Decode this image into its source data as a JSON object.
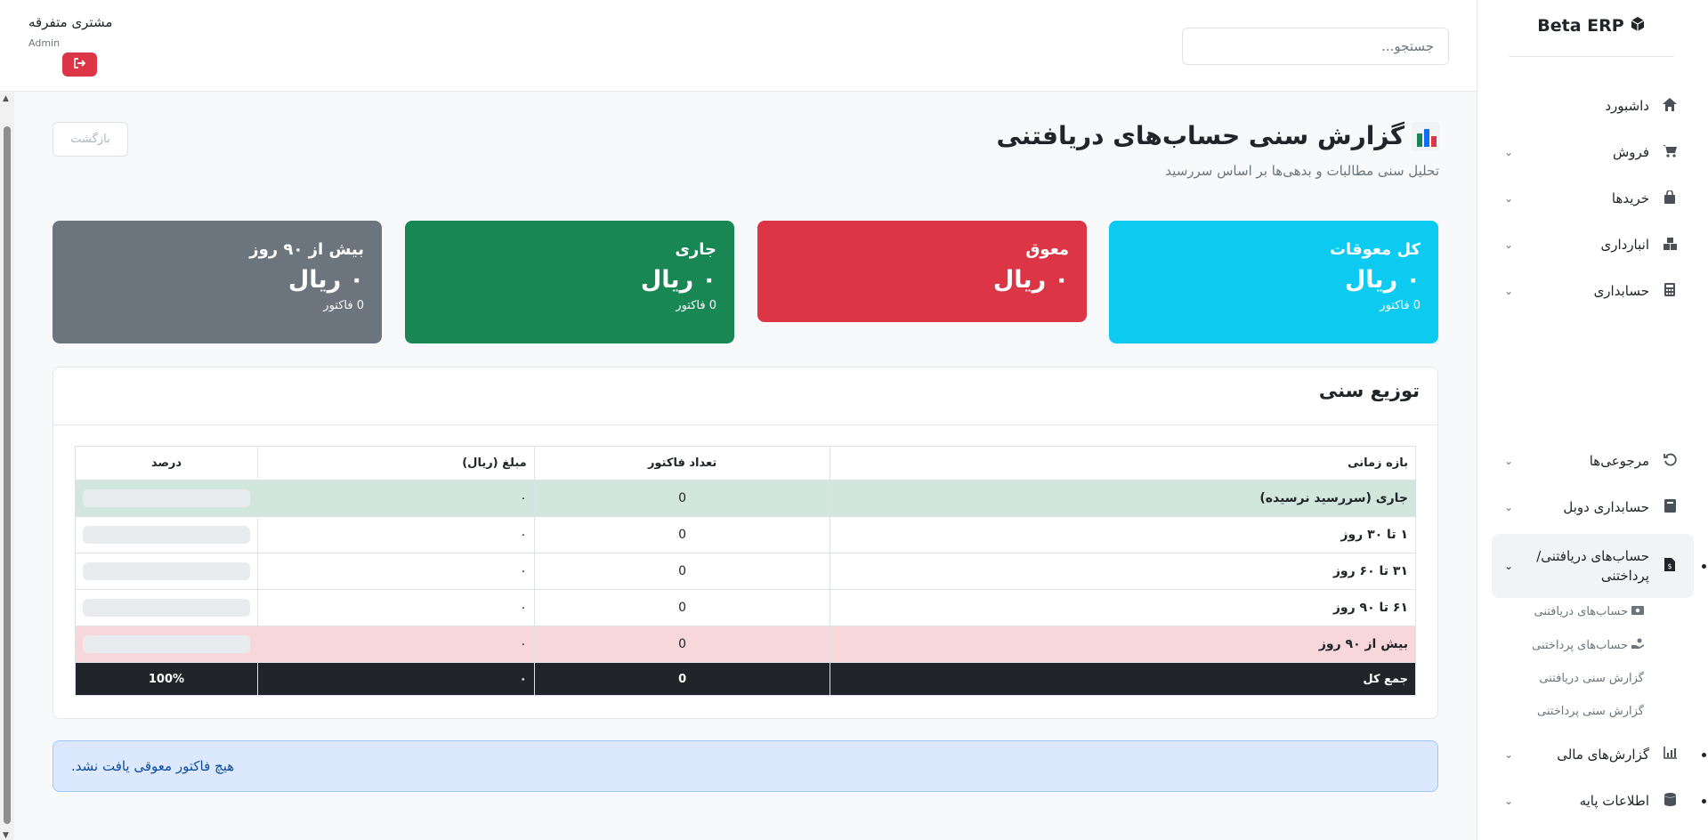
{
  "brand": {
    "title": "Beta ERP",
    "icon": "cube-icon"
  },
  "sidebar": {
    "items": [
      {
        "label": "داشبورد",
        "icon": "home-icon",
        "has_chevron": false
      },
      {
        "label": "فروش",
        "icon": "cart-icon",
        "has_chevron": true
      },
      {
        "label": "خریدها",
        "icon": "bag-icon",
        "has_chevron": true
      },
      {
        "label": "انبارداری",
        "icon": "warehouse-icon",
        "has_chevron": true
      },
      {
        "label": "حسابداری",
        "icon": "calculator-icon",
        "has_chevron": true
      },
      {
        "label": "مرجوعی‌ها",
        "icon": "undo-icon",
        "has_chevron": true
      },
      {
        "label": "حسابداری دوبل",
        "icon": "book-icon",
        "has_chevron": true
      },
      {
        "label": "حساب‌های دریافتنی/\nپرداختنی",
        "icon": "invoice-dollar-icon",
        "has_chevron": true,
        "active": true
      },
      {
        "label": "گزارش‌های مالی",
        "icon": "chart-icon",
        "has_chevron": true
      },
      {
        "label": "اطلاعات پایه",
        "icon": "database-icon",
        "has_chevron": true
      }
    ],
    "sub_items": [
      {
        "label": "حساب‌های دریافتنی",
        "icon": "money-icon"
      },
      {
        "label": "حساب‌های پرداختنی",
        "icon": "hand-money-icon"
      },
      {
        "label": "گزارش سنی دریافتنی"
      },
      {
        "label": "گزارش سنی پرداختنی"
      }
    ]
  },
  "header": {
    "search_placeholder": "جستجو...",
    "user_name": "مشتری متفرقه",
    "user_role": "Admin",
    "logout_icon": "sign-out-icon"
  },
  "page": {
    "title": "گزارش سنی حساب‌های دریافتنی",
    "subtitle": "تحلیل سنی مطالبات و بدهی‌ها بر اساس سررسید",
    "back_label": "بازگشت"
  },
  "cards": [
    {
      "label": "کل معوقات",
      "amount": "۰ ریال",
      "count": "0 فاکتور",
      "color": "#0dcaf0"
    },
    {
      "label": "معوق",
      "amount": "۰ ریال",
      "count": "",
      "color": "#dc3545"
    },
    {
      "label": "جاری",
      "amount": "۰ ریال",
      "count": "0 فاکتور",
      "color": "#198754"
    },
    {
      "label": "بیش از ۹۰ روز",
      "amount": "۰ ریال",
      "count": "0 فاکتور",
      "color": "#6c757d"
    }
  ],
  "distribution": {
    "title": "توزیع سنی",
    "headers": [
      "بازه زمانی",
      "تعداد فاکتور",
      "مبلغ (ریال)",
      "درصد"
    ],
    "rows": [
      {
        "period": "جاری (سررسید نرسیده)",
        "count": "0",
        "amount": "۰",
        "percent": 0
      },
      {
        "period": "۱ تا ۳۰ روز",
        "count": "0",
        "amount": "۰",
        "percent": 0
      },
      {
        "period": "۳۱ تا ۶۰ روز",
        "count": "0",
        "amount": "۰",
        "percent": 0
      },
      {
        "period": "۶۱ تا ۹۰ روز",
        "count": "0",
        "amount": "۰",
        "percent": 0
      },
      {
        "period": "بیش از ۹۰ روز",
        "count": "0",
        "amount": "۰",
        "percent": 0
      }
    ],
    "total": {
      "label": "جمع کل",
      "count": "0",
      "amount": "۰",
      "percent": "100%"
    }
  },
  "alert": {
    "text": "هیچ فاکتور معوقی یافت نشد."
  }
}
